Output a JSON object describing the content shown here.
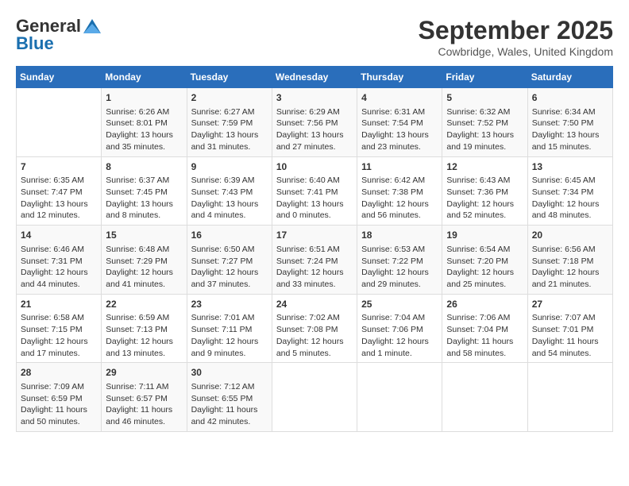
{
  "header": {
    "logo_general": "General",
    "logo_blue": "Blue",
    "month_year": "September 2025",
    "location": "Cowbridge, Wales, United Kingdom"
  },
  "calendar": {
    "days_of_week": [
      "Sunday",
      "Monday",
      "Tuesday",
      "Wednesday",
      "Thursday",
      "Friday",
      "Saturday"
    ],
    "weeks": [
      [
        {
          "day": "",
          "info": ""
        },
        {
          "day": "1",
          "info": "Sunrise: 6:26 AM\nSunset: 8:01 PM\nDaylight: 13 hours\nand 35 minutes."
        },
        {
          "day": "2",
          "info": "Sunrise: 6:27 AM\nSunset: 7:59 PM\nDaylight: 13 hours\nand 31 minutes."
        },
        {
          "day": "3",
          "info": "Sunrise: 6:29 AM\nSunset: 7:56 PM\nDaylight: 13 hours\nand 27 minutes."
        },
        {
          "day": "4",
          "info": "Sunrise: 6:31 AM\nSunset: 7:54 PM\nDaylight: 13 hours\nand 23 minutes."
        },
        {
          "day": "5",
          "info": "Sunrise: 6:32 AM\nSunset: 7:52 PM\nDaylight: 13 hours\nand 19 minutes."
        },
        {
          "day": "6",
          "info": "Sunrise: 6:34 AM\nSunset: 7:50 PM\nDaylight: 13 hours\nand 15 minutes."
        }
      ],
      [
        {
          "day": "7",
          "info": "Sunrise: 6:35 AM\nSunset: 7:47 PM\nDaylight: 13 hours\nand 12 minutes."
        },
        {
          "day": "8",
          "info": "Sunrise: 6:37 AM\nSunset: 7:45 PM\nDaylight: 13 hours\nand 8 minutes."
        },
        {
          "day": "9",
          "info": "Sunrise: 6:39 AM\nSunset: 7:43 PM\nDaylight: 13 hours\nand 4 minutes."
        },
        {
          "day": "10",
          "info": "Sunrise: 6:40 AM\nSunset: 7:41 PM\nDaylight: 13 hours\nand 0 minutes."
        },
        {
          "day": "11",
          "info": "Sunrise: 6:42 AM\nSunset: 7:38 PM\nDaylight: 12 hours\nand 56 minutes."
        },
        {
          "day": "12",
          "info": "Sunrise: 6:43 AM\nSunset: 7:36 PM\nDaylight: 12 hours\nand 52 minutes."
        },
        {
          "day": "13",
          "info": "Sunrise: 6:45 AM\nSunset: 7:34 PM\nDaylight: 12 hours\nand 48 minutes."
        }
      ],
      [
        {
          "day": "14",
          "info": "Sunrise: 6:46 AM\nSunset: 7:31 PM\nDaylight: 12 hours\nand 44 minutes."
        },
        {
          "day": "15",
          "info": "Sunrise: 6:48 AM\nSunset: 7:29 PM\nDaylight: 12 hours\nand 41 minutes."
        },
        {
          "day": "16",
          "info": "Sunrise: 6:50 AM\nSunset: 7:27 PM\nDaylight: 12 hours\nand 37 minutes."
        },
        {
          "day": "17",
          "info": "Sunrise: 6:51 AM\nSunset: 7:24 PM\nDaylight: 12 hours\nand 33 minutes."
        },
        {
          "day": "18",
          "info": "Sunrise: 6:53 AM\nSunset: 7:22 PM\nDaylight: 12 hours\nand 29 minutes."
        },
        {
          "day": "19",
          "info": "Sunrise: 6:54 AM\nSunset: 7:20 PM\nDaylight: 12 hours\nand 25 minutes."
        },
        {
          "day": "20",
          "info": "Sunrise: 6:56 AM\nSunset: 7:18 PM\nDaylight: 12 hours\nand 21 minutes."
        }
      ],
      [
        {
          "day": "21",
          "info": "Sunrise: 6:58 AM\nSunset: 7:15 PM\nDaylight: 12 hours\nand 17 minutes."
        },
        {
          "day": "22",
          "info": "Sunrise: 6:59 AM\nSunset: 7:13 PM\nDaylight: 12 hours\nand 13 minutes."
        },
        {
          "day": "23",
          "info": "Sunrise: 7:01 AM\nSunset: 7:11 PM\nDaylight: 12 hours\nand 9 minutes."
        },
        {
          "day": "24",
          "info": "Sunrise: 7:02 AM\nSunset: 7:08 PM\nDaylight: 12 hours\nand 5 minutes."
        },
        {
          "day": "25",
          "info": "Sunrise: 7:04 AM\nSunset: 7:06 PM\nDaylight: 12 hours\nand 1 minute."
        },
        {
          "day": "26",
          "info": "Sunrise: 7:06 AM\nSunset: 7:04 PM\nDaylight: 11 hours\nand 58 minutes."
        },
        {
          "day": "27",
          "info": "Sunrise: 7:07 AM\nSunset: 7:01 PM\nDaylight: 11 hours\nand 54 minutes."
        }
      ],
      [
        {
          "day": "28",
          "info": "Sunrise: 7:09 AM\nSunset: 6:59 PM\nDaylight: 11 hours\nand 50 minutes."
        },
        {
          "day": "29",
          "info": "Sunrise: 7:11 AM\nSunset: 6:57 PM\nDaylight: 11 hours\nand 46 minutes."
        },
        {
          "day": "30",
          "info": "Sunrise: 7:12 AM\nSunset: 6:55 PM\nDaylight: 11 hours\nand 42 minutes."
        },
        {
          "day": "",
          "info": ""
        },
        {
          "day": "",
          "info": ""
        },
        {
          "day": "",
          "info": ""
        },
        {
          "day": "",
          "info": ""
        }
      ]
    ]
  }
}
